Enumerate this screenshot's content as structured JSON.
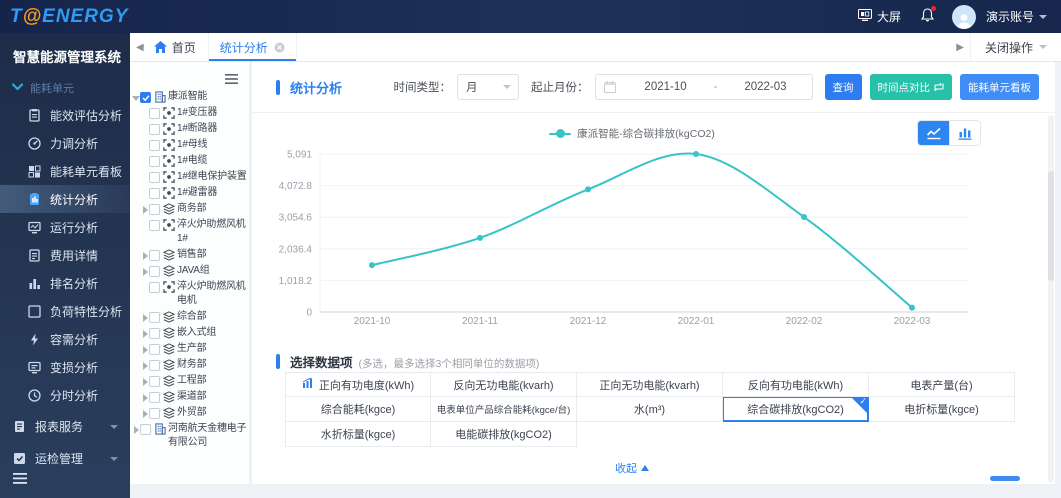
{
  "header": {
    "brand_t": "T",
    "brand_at": "@",
    "brand_rest": "ENERGY",
    "big_screen": "大屏",
    "account": "演示账号"
  },
  "sidebar": {
    "title": "智慧能源管理系统",
    "group": "能耗单元",
    "items": [
      {
        "label": "能效评估分析",
        "icon": "clipboard"
      },
      {
        "label": "力调分析",
        "icon": "gauge"
      },
      {
        "label": "能耗单元看板",
        "icon": "board"
      },
      {
        "label": "统计分析",
        "icon": "stats",
        "active": true
      },
      {
        "label": "运行分析",
        "icon": "monitor"
      },
      {
        "label": "费用详情",
        "icon": "doc"
      },
      {
        "label": "排名分析",
        "icon": "rank"
      },
      {
        "label": "负荷特性分析",
        "icon": "load"
      },
      {
        "label": "容需分析",
        "icon": "bolt"
      },
      {
        "label": "变损分析",
        "icon": "loss"
      },
      {
        "label": "分时分析",
        "icon": "clock"
      }
    ],
    "top_items": [
      {
        "label": "报表服务",
        "icon": "report"
      },
      {
        "label": "运检管理",
        "icon": "ops"
      }
    ]
  },
  "tabbar": {
    "home": "首页",
    "tab": "统计分析",
    "close_ops": "关闭操作"
  },
  "tree": {
    "items": [
      {
        "label": "康派智能",
        "kind": "company",
        "caret": "down",
        "checked": true,
        "level": 0
      },
      {
        "label": "1#变压器",
        "kind": "device",
        "level": 1
      },
      {
        "label": "1#断路器",
        "kind": "device",
        "level": 1
      },
      {
        "label": "1#母线",
        "kind": "device",
        "level": 1
      },
      {
        "label": "1#电缆",
        "kind": "device",
        "level": 1
      },
      {
        "label": "1#继电保护装置",
        "kind": "device",
        "level": 1
      },
      {
        "label": "1#避雷器",
        "kind": "device",
        "level": 1
      },
      {
        "label": "商务部",
        "kind": "dept",
        "caret": "right",
        "level": 1
      },
      {
        "label": "淬火炉助燃风机1#",
        "kind": "device",
        "level": 1
      },
      {
        "label": "销售部",
        "kind": "dept",
        "caret": "right",
        "level": 1
      },
      {
        "label": "JAVA组",
        "kind": "dept",
        "caret": "right",
        "level": 1
      },
      {
        "label": "淬火炉助燃风机电机",
        "kind": "device",
        "level": 1
      },
      {
        "label": "综合部",
        "kind": "dept",
        "caret": "right",
        "level": 1
      },
      {
        "label": "嵌入式组",
        "kind": "dept",
        "caret": "right",
        "level": 1
      },
      {
        "label": "生产部",
        "kind": "dept",
        "caret": "right",
        "level": 1
      },
      {
        "label": "财务部",
        "kind": "dept",
        "caret": "right",
        "level": 1
      },
      {
        "label": "工程部",
        "kind": "dept",
        "caret": "right",
        "level": 1
      },
      {
        "label": "渠道部",
        "kind": "dept",
        "caret": "right",
        "level": 1
      },
      {
        "label": "外贸部",
        "kind": "dept",
        "caret": "right",
        "level": 1
      },
      {
        "label": "河南航天金穗电子有限公司",
        "kind": "company",
        "caret": "right",
        "level": 0
      }
    ]
  },
  "panel": {
    "title": "统计分析",
    "time_type_label": "时间类型：",
    "time_type_value": "月",
    "range_label": "起止月份：",
    "range_start": "2021-10",
    "range_sep": "-",
    "range_end": "2022-03",
    "search_btn": "查询",
    "compare_btn": "时间点对比",
    "board_btn": "能耗单元看板"
  },
  "chart_data": {
    "type": "line",
    "categories": [
      "2021-10",
      "2021-11",
      "2021-12",
      "2022-01",
      "2022-02",
      "2022-03"
    ],
    "series": [
      {
        "name": "康派智能-综合碳排放(kgCO2)",
        "values": [
          1510,
          2390,
          3950,
          5091,
          3060,
          140
        ]
      }
    ],
    "ylim": [
      0,
      5091
    ],
    "yticks": [
      0,
      1018.2,
      2036.4,
      3054.6,
      4072.8,
      5091
    ],
    "ytick_labels": [
      "0",
      "1,018.2",
      "2,036.4",
      "3,054.6",
      "4,072.8",
      "5,091"
    ],
    "grid": true,
    "legend_position": "top-center",
    "line_color": "#36c4c6"
  },
  "datagrid": {
    "title": "选择数据项",
    "note": "(多选，最多选择3个相同单位的数据项)",
    "rows": [
      [
        {
          "label": "正向有功电度(kWh)",
          "icon": "chart"
        },
        {
          "label": "反向无功电能(kvarh)"
        },
        {
          "label": "正向无功电能(kvarh)"
        },
        {
          "label": "反向有功电能(kWh)"
        },
        {
          "label": "电表产量(台)"
        }
      ],
      [
        {
          "label": "综合能耗(kgce)"
        },
        {
          "label": "电表单位产品综合能耗(kgce/台)",
          "small": true
        },
        {
          "label": "水(m³)"
        },
        {
          "label": "综合碳排放(kgCO2)",
          "selected": true
        },
        {
          "label": "电折标量(kgce)"
        }
      ],
      [
        {
          "label": "水折标量(kgce)"
        },
        {
          "label": "电能碳排放(kgCO2)"
        },
        null,
        null,
        null
      ]
    ],
    "collapse": "收起"
  }
}
